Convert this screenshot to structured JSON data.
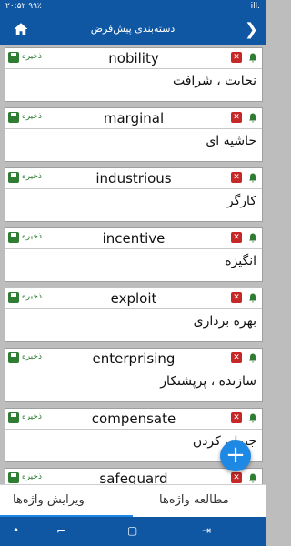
{
  "status": {
    "time": "۲۰:۵۲",
    "battery": "۹۹٪",
    "signal": "ill."
  },
  "header": {
    "title": "دسته‌بندی پیش‌فرض",
    "back_icon": "arrow-right-icon",
    "home_icon": "home-icon"
  },
  "save_label": "ذخیره",
  "cards": [
    {
      "word": "nobility",
      "meaning": "نجابت ، شرافت"
    },
    {
      "word": "marginal",
      "meaning": "حاشیه ای"
    },
    {
      "word": "industrious",
      "meaning": "کارگر"
    },
    {
      "word": "incentive",
      "meaning": "انگیزه"
    },
    {
      "word": "exploit",
      "meaning": "بهره برداری"
    },
    {
      "word": "enterprising",
      "meaning": "سازنده ، پرپشتکار"
    },
    {
      "word": "compensate",
      "meaning": "جبران کردن"
    },
    {
      "word": "safeguard",
      "meaning": ""
    }
  ],
  "fab": {
    "label": "+"
  },
  "tabs": {
    "edit": "ویرایش واژه‌ها",
    "study": "مطالعه واژه‌ها"
  },
  "colors": {
    "primary": "#0f57a3",
    "accent": "#1e88e5",
    "save": "#2e7d32",
    "delete": "#c62828",
    "bell": "#2e7d32"
  }
}
